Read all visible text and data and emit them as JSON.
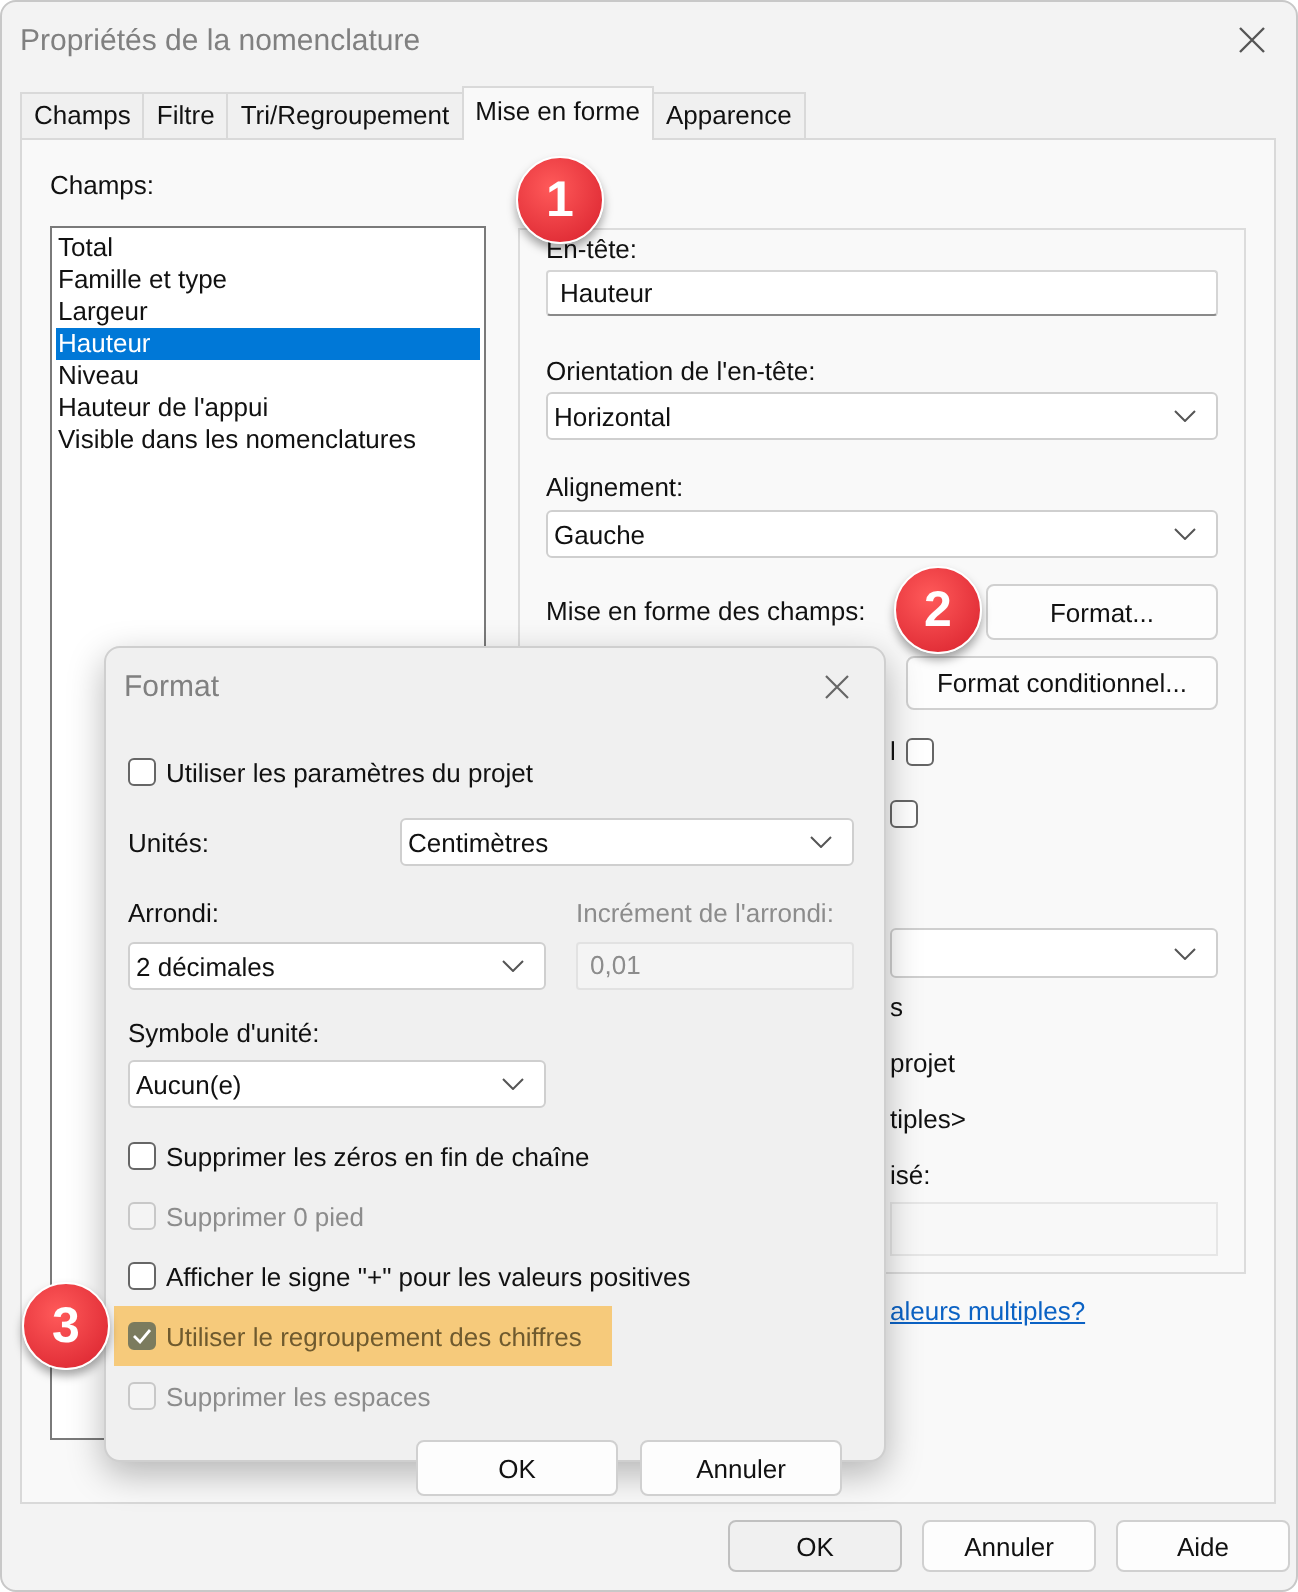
{
  "window": {
    "title": "Propriétés de la nomenclature"
  },
  "tabs": [
    {
      "label": "Champs",
      "selected": false
    },
    {
      "label": "Filtre",
      "selected": false
    },
    {
      "label": "Tri/Regroupement",
      "selected": false
    },
    {
      "label": "Mise en forme",
      "selected": true
    },
    {
      "label": "Apparence",
      "selected": false
    }
  ],
  "fields": {
    "label": "Champs:",
    "items": [
      {
        "text": "Total",
        "selected": false
      },
      {
        "text": "Famille et type",
        "selected": false
      },
      {
        "text": "Largeur",
        "selected": false
      },
      {
        "text": "Hauteur",
        "selected": true
      },
      {
        "text": "Niveau",
        "selected": false
      },
      {
        "text": "Hauteur de l'appui",
        "selected": false
      },
      {
        "text": "Visible dans les nomenclatures",
        "selected": false
      }
    ]
  },
  "heading": {
    "label": "En-tête:",
    "value": "Hauteur"
  },
  "orientation": {
    "label": "Orientation de l'en-tête:",
    "value": "Horizontal"
  },
  "alignment": {
    "label": "Alignement:",
    "value": "Gauche"
  },
  "field_format": {
    "label": "Mise en forme des champs:",
    "button": "Format...",
    "conditional_button": "Format conditionnel..."
  },
  "obscured_rows": [
    {
      "kind": "checkbox",
      "label": "l",
      "checked": false
    },
    {
      "kind": "checkbox",
      "checked": false
    },
    {
      "kind": "select"
    },
    {
      "kind": "text",
      "text": "s"
    },
    {
      "kind": "text",
      "text": "projet"
    },
    {
      "kind": "text",
      "text": "tiples>"
    },
    {
      "kind": "text",
      "text": "isé:"
    },
    {
      "kind": "field"
    },
    {
      "kind": "link",
      "text": "aleurs multiples?"
    }
  ],
  "buttons": [
    "OK",
    "Annuler",
    "Aide"
  ],
  "format_dialog": {
    "title": "Format",
    "use_project": {
      "label": "Utiliser les paramètres du projet",
      "checked": false
    },
    "units": {
      "label": "Unités:",
      "value": "Centimètres"
    },
    "rounding": {
      "label": "Arrondi:",
      "value": "2 décimales"
    },
    "increment": {
      "label": "Incrément de l'arrondi:",
      "value": "0,01",
      "disabled": true
    },
    "unit_symbol": {
      "label": "Symbole d'unité:",
      "value": "Aucun(e)"
    },
    "options": [
      {
        "label": "Supprimer les zéros en fin de chaîne",
        "checked": false,
        "disabled": false,
        "highlighted": false
      },
      {
        "label": "Supprimer 0 pied",
        "checked": false,
        "disabled": true,
        "highlighted": false
      },
      {
        "label": "Afficher le signe \"+\" pour les valeurs positives",
        "checked": false,
        "disabled": false,
        "highlighted": false
      },
      {
        "label": "Utiliser le regroupement des chiffres",
        "checked": true,
        "disabled": true,
        "highlighted": true
      },
      {
        "label": "Supprimer les espaces",
        "checked": false,
        "disabled": true,
        "highlighted": false
      }
    ],
    "buttons": [
      "OK",
      "Annuler"
    ]
  },
  "callouts": [
    "1",
    "2",
    "3"
  ]
}
